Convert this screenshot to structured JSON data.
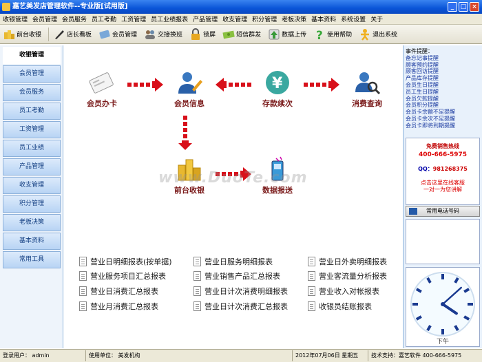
{
  "window": {
    "title": "嘉艺美发店管理软件--专业版[试用版]"
  },
  "menu": [
    "收银管理",
    "会员管理",
    "会员服务",
    "员工考勤",
    "工资管理",
    "员工业绩报表",
    "产品管理",
    "收支管理",
    "积分管理",
    "老板决策",
    "基本资料",
    "系统设置",
    "关于"
  ],
  "toolbar": [
    "前台收银",
    "店长看板",
    "会员管理",
    "交接换班",
    "锁屏",
    "短信群发",
    "数据上传",
    "使用帮助",
    "退出系统"
  ],
  "sidebar": {
    "items": [
      "收银管理",
      "会员管理",
      "会员服务",
      "员工考勤",
      "工资管理",
      "员工业绩",
      "产品管理",
      "收支管理",
      "积分管理",
      "老板决策",
      "基本资料",
      "常用工具"
    ]
  },
  "flow": {
    "card": "会员办卡",
    "info": "会员信息",
    "deposit": "存款续次",
    "query": "消费查询",
    "cashier": "前台收银",
    "report": "数据报送"
  },
  "reports": [
    [
      "营业日明细报表(按单据)",
      "营业日服务明细报表",
      "营业日外卖明细报表"
    ],
    [
      "营业服务项目汇总报表",
      "营业销售产品汇总报表",
      "营业客流量分析报表"
    ],
    [
      "营业日消费汇总报表",
      "营业日计次消费明细报表",
      "营业收入对帐报表"
    ],
    [
      "营业月消费汇总报表",
      "营业日计次消费汇总报表",
      "收银员结账报表"
    ]
  ],
  "reminders": {
    "header": "事件提醒：",
    "items": [
      "备忘记事提醒",
      "顾客预约提醒",
      "顾客回访提醒",
      "产品库存提醒",
      "会员生日提醒",
      "员工生日提醒",
      "会员欠款提醒",
      "会员积分提醒",
      "会员卡余额不足提醒",
      "会员卡余次不足提醒",
      "会员卡即将到期提醒"
    ]
  },
  "hotline": {
    "title": "免费销售热线",
    "phone": "400-666-5975",
    "qq_label": "QQ：",
    "qq": "981268375",
    "online": "点击这里在线客服",
    "online2": "一对一为您讲解"
  },
  "phone_button": "常用电话号码",
  "clock": {
    "time_label": "下午",
    "hour": 4,
    "minute": 8
  },
  "statusbar": {
    "user_label": "登录用户：",
    "user": "admin",
    "unit_label": "使用单位：",
    "unit": "美发机构",
    "date": "2012年07月06日 星期五",
    "support": "技术支持：嘉艺软件 400-666-5975"
  },
  "watermark": "www.DuoTe.com",
  "colors": {
    "accent": "#0a55d8",
    "flow_text": "#7a1a1a",
    "arrow": "#d8101a"
  }
}
